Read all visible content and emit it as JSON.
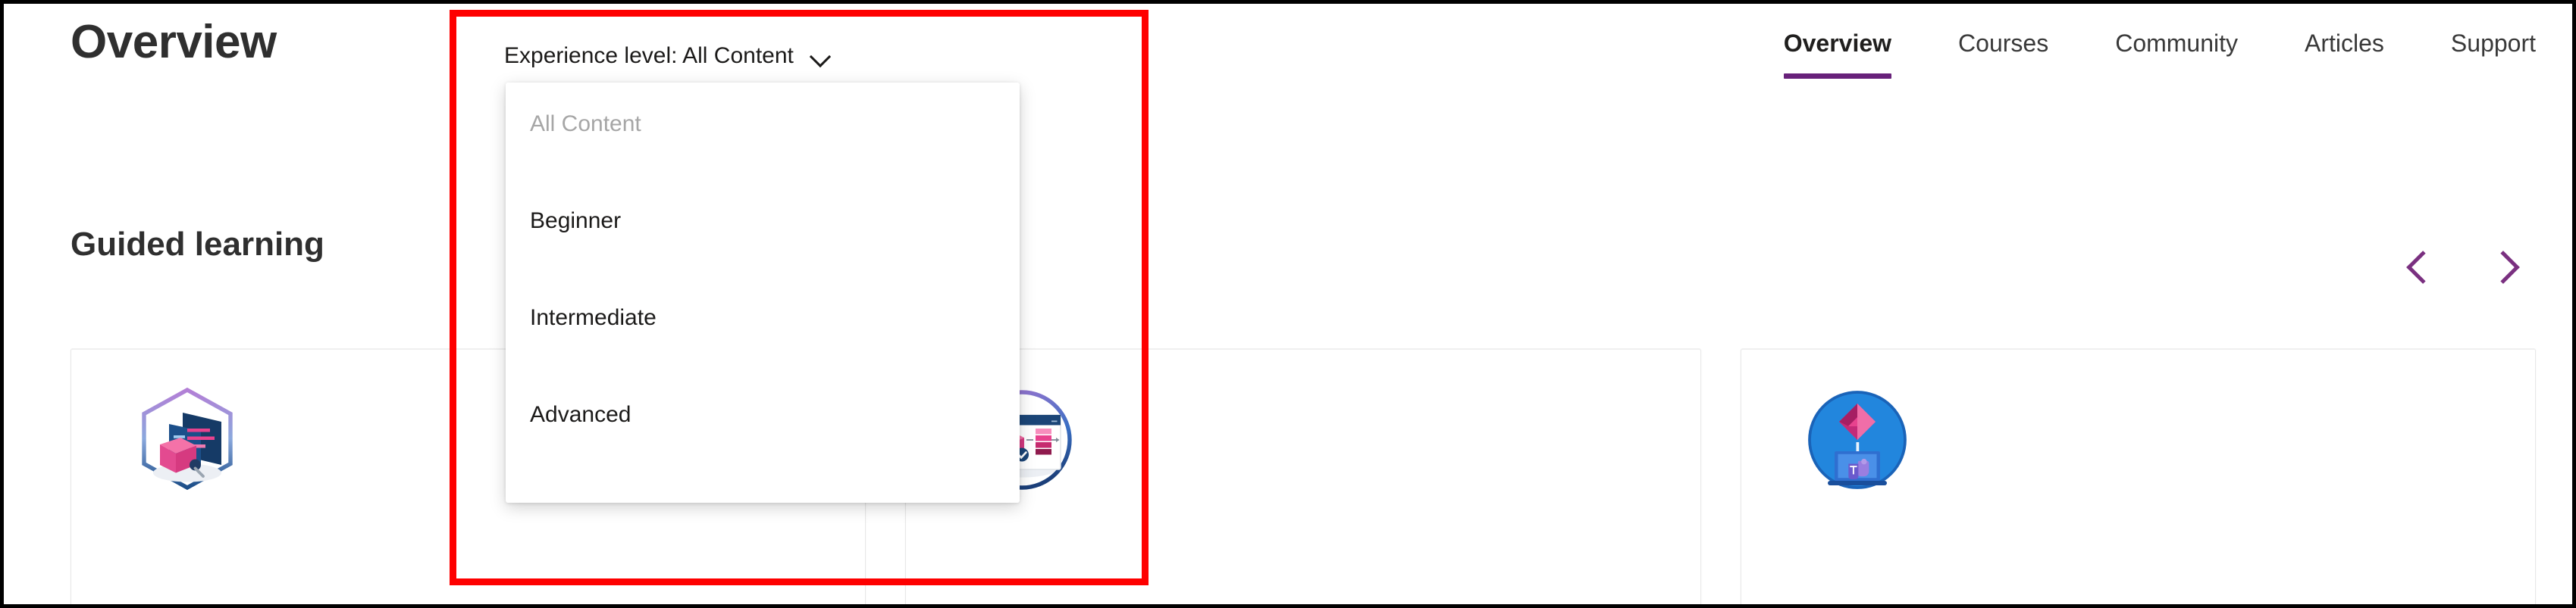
{
  "page": {
    "title": "Overview",
    "section_title": "Guided learning"
  },
  "filter": {
    "button_label": "Experience level: All Content",
    "chevron_icon": "chevron-down-icon",
    "selected": "All Content",
    "options": [
      {
        "label": "All Content",
        "state": "disabled"
      },
      {
        "label": "Beginner",
        "state": "enabled"
      },
      {
        "label": "Intermediate",
        "state": "enabled"
      },
      {
        "label": "Advanced",
        "state": "enabled"
      }
    ]
  },
  "top_nav": {
    "items": [
      {
        "label": "Overview",
        "active": true
      },
      {
        "label": "Courses",
        "active": false
      },
      {
        "label": "Community",
        "active": false
      },
      {
        "label": "Articles",
        "active": false
      },
      {
        "label": "Support",
        "active": false
      }
    ],
    "active_underline_color": "#68217a"
  },
  "carousel": {
    "prev_icon": "chevron-left-icon",
    "next_icon": "chevron-right-icon",
    "arrow_color": "#7a3080"
  },
  "cards": [
    {
      "icon_name": "hexagon-badge-dashboard-icon"
    },
    {
      "icon_name": "circle-badge-window-cube-icon"
    },
    {
      "icon_name": "blue-circle-powerbi-teams-laptop-icon"
    }
  ],
  "annotation": {
    "color": "#fe0000",
    "target": "experience-level-dropdown"
  }
}
